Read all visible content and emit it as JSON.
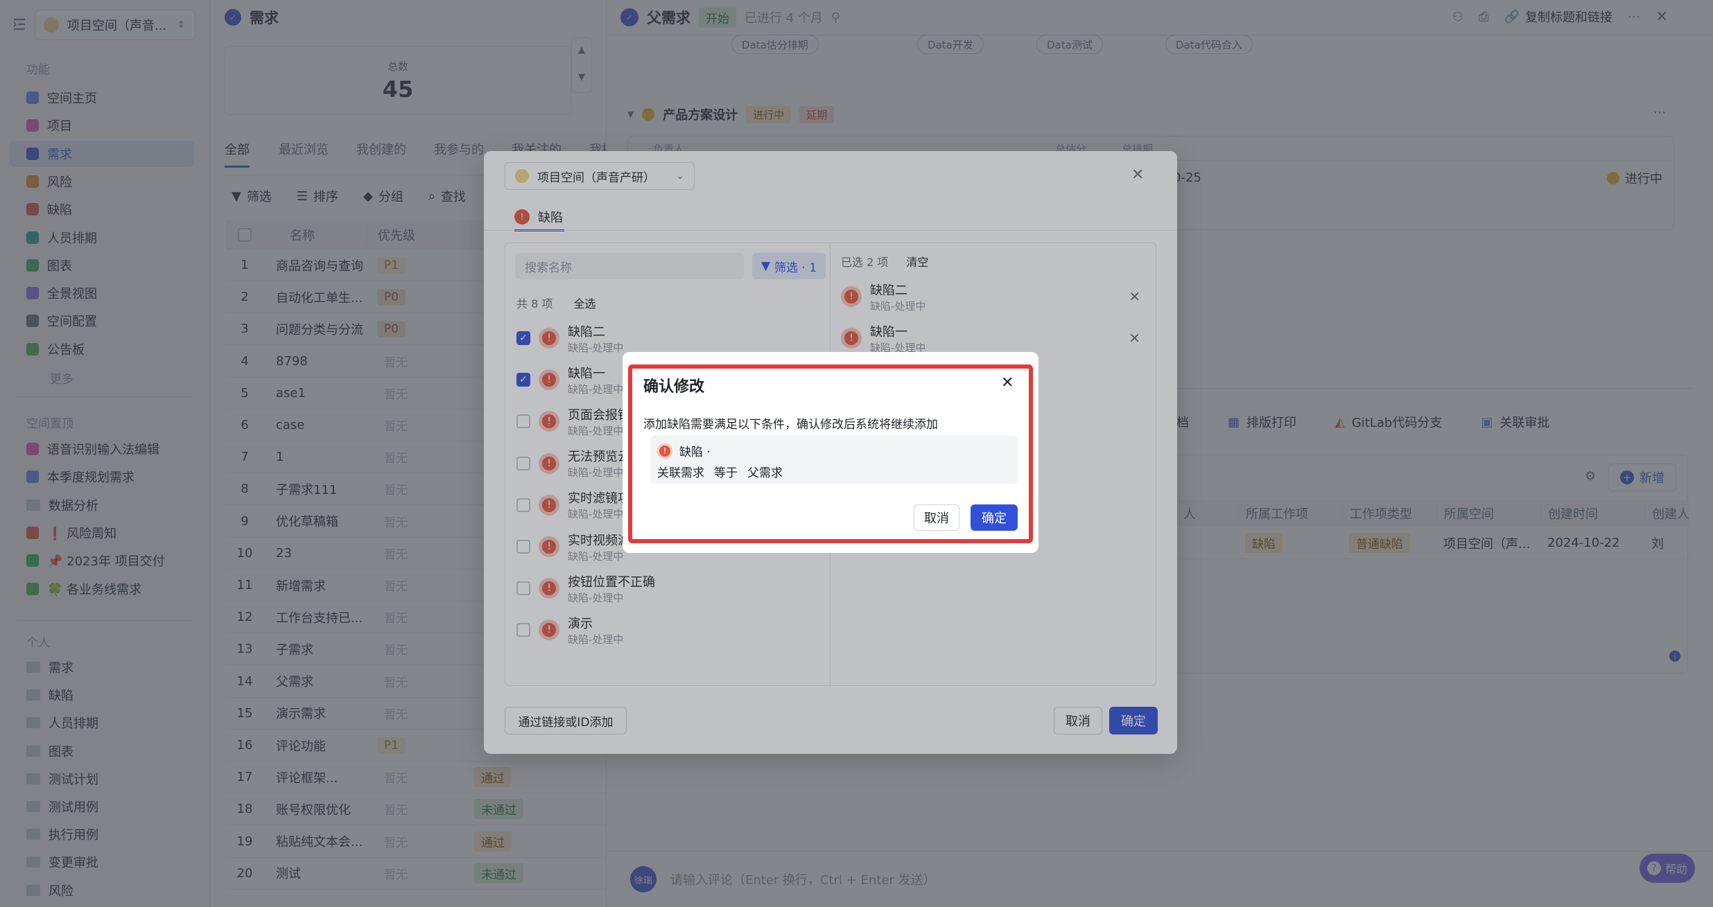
{
  "sidebar": {
    "workspace": "项目空间（声音...",
    "section_features": "功能",
    "features": [
      {
        "label": "空间主页",
        "color": "#6b7cf0"
      },
      {
        "label": "项目",
        "color": "#e05ba7"
      },
      {
        "label": "需求",
        "color": "#3250d8"
      },
      {
        "label": "风险",
        "color": "#e58a2a"
      },
      {
        "label": "缺陷",
        "color": "#e2553f"
      },
      {
        "label": "人员排期",
        "color": "#19a88b"
      },
      {
        "label": "图表",
        "color": "#2fb06b"
      },
      {
        "label": "全景视图",
        "color": "#8c6cf0"
      },
      {
        "label": "空间配置",
        "color": "#646a73"
      },
      {
        "label": "公告板",
        "color": "#43b347"
      }
    ],
    "more": "更多",
    "section_pinned": "空间置顶",
    "pinned": [
      {
        "label": "语音识别输入法编辑",
        "color": "#e05ba7"
      },
      {
        "label": "本季度规划需求",
        "color": "#6b7cf0"
      },
      {
        "label": "数据分析",
        "color": ""
      },
      {
        "label": "❗ 风险周知",
        "color": "#e2553f"
      },
      {
        "label": "📌 2023年 项目交付",
        "color": "#2fb06b"
      },
      {
        "label": "🍀 各业务线需求",
        "color": "#43b347"
      }
    ],
    "section_personal": "个人",
    "personal": [
      "需求",
      "缺陷",
      "人员排期",
      "图表",
      "测试计划",
      "测试用例",
      "执行用例",
      "变更审批",
      "风险"
    ]
  },
  "list": {
    "title": "需求",
    "total_label": "总数",
    "total_value": "45",
    "tabs": [
      "全部",
      "最近浏览",
      "我创建的",
      "我参与的",
      "我关注的",
      "我批"
    ],
    "toolbar": [
      "筛选",
      "排序",
      "分组",
      "查找"
    ],
    "col_name": "名称",
    "col_priority": "优先级",
    "rows": [
      {
        "n": "1",
        "name": "商品咨询与查询",
        "pri": "P1",
        "pc": "p1",
        "st": "",
        "sc": ""
      },
      {
        "n": "2",
        "name": "自动化工单生...",
        "pri": "P0",
        "pc": "p0",
        "st": "",
        "sc": ""
      },
      {
        "n": "3",
        "name": "问题分类与分流",
        "pri": "P0",
        "pc": "p0",
        "st": "",
        "sc": ""
      },
      {
        "n": "4",
        "name": "8798",
        "pri": "暂无",
        "pc": "pnone",
        "st": "",
        "sc": ""
      },
      {
        "n": "5",
        "name": "ase1",
        "pri": "暂无",
        "pc": "pnone",
        "st": "",
        "sc": ""
      },
      {
        "n": "6",
        "name": "case",
        "pri": "暂无",
        "pc": "pnone",
        "st": "",
        "sc": ""
      },
      {
        "n": "7",
        "name": "1",
        "pri": "暂无",
        "pc": "pnone",
        "st": "",
        "sc": ""
      },
      {
        "n": "8",
        "name": "子需求111",
        "pri": "暂无",
        "pc": "pnone",
        "st": "",
        "sc": ""
      },
      {
        "n": "9",
        "name": "优化草稿箱",
        "pri": "暂无",
        "pc": "pnone",
        "st": "",
        "sc": ""
      },
      {
        "n": "10",
        "name": "23",
        "pri": "暂无",
        "pc": "pnone",
        "st": "",
        "sc": ""
      },
      {
        "n": "11",
        "name": "新增需求",
        "pri": "暂无",
        "pc": "pnone",
        "st": "",
        "sc": ""
      },
      {
        "n": "12",
        "name": "工作台支持已...",
        "pri": "暂无",
        "pc": "pnone",
        "st": "",
        "sc": ""
      },
      {
        "n": "13",
        "name": "子需求",
        "pri": "暂无",
        "pc": "pnone",
        "st": "",
        "sc": ""
      },
      {
        "n": "14",
        "name": "父需求",
        "pri": "暂无",
        "pc": "pnone",
        "st": "",
        "sc": ""
      },
      {
        "n": "15",
        "name": "演示需求",
        "pri": "暂无",
        "pc": "pnone",
        "st": "",
        "sc": ""
      },
      {
        "n": "16",
        "name": "评论功能",
        "pri": "P1",
        "pc": "p1",
        "st": "",
        "sc": ""
      },
      {
        "n": "17",
        "name": "评论框架...",
        "pri": "暂无",
        "pc": "pnone",
        "st": "通过",
        "sc": "pass"
      },
      {
        "n": "18",
        "name": "账号权限优化",
        "pri": "暂无",
        "pc": "pnone",
        "st": "未通过",
        "sc": "nopass"
      },
      {
        "n": "19",
        "name": "粘贴纯文本会...",
        "pri": "暂无",
        "pc": "pnone",
        "st": "通过",
        "sc": "pass"
      },
      {
        "n": "20",
        "name": "测试",
        "pri": "暂无",
        "pc": "pnone",
        "st": "未通过",
        "sc": "nopass"
      }
    ]
  },
  "detail": {
    "title": "父需求",
    "status": "开始",
    "elapsed": "已进行 4 个月",
    "copy_link": "复制标题和链接",
    "flow_nodes": [
      "Data估分排期",
      "Data开发",
      "Data测试",
      "Data代码合入"
    ],
    "stage_name": "产品方案设计",
    "stage_status": "进行中",
    "stage_delay": "延期",
    "stage_col_owner": "负责人",
    "stage_col_points": "总估分",
    "stage_col_schedule": "总排期",
    "stage_date": "0-25",
    "stage_state": "进行中",
    "tabs_lower": [
      "档",
      "排版打印",
      "GitLab代码分支",
      "关联审批"
    ],
    "new_label": "新增",
    "table_cols": [
      "人",
      "所属工作项",
      "工作项类型",
      "所属空间",
      "创建时间",
      "创建人"
    ],
    "table_row": [
      "",
      "缺陷",
      "普通缺陷",
      "项目空间（声...",
      "2024-10-22",
      "刘"
    ],
    "comment_avatar": "徐瑞",
    "comment_placeholder": "请输入评论（Enter 换行，Ctrl + Enter 发送）",
    "help": "帮助"
  },
  "dialog": {
    "space_select": "项目空间（声音产研）",
    "tab": "缺陷",
    "search_placeholder": "搜索名称",
    "filter_label": "筛选 · 1",
    "total_label": "共 8 项",
    "select_all": "全选",
    "items": [
      {
        "name": "缺陷二",
        "sub": "缺陷-处理中",
        "checked": true
      },
      {
        "name": "缺陷一",
        "sub": "缺陷-处理中",
        "checked": true
      },
      {
        "name": "页面会报错",
        "sub": "缺陷-处理中",
        "checked": false
      },
      {
        "name": "无法预览云",
        "sub": "缺陷-处理中",
        "checked": false
      },
      {
        "name": "实时滤镜功",
        "sub": "缺陷-处理中",
        "checked": false
      },
      {
        "name": "实时视频滤",
        "sub": "缺陷-处理中",
        "checked": false
      },
      {
        "name": "按钮位置不正确",
        "sub": "缺陷-处理中",
        "checked": false
      },
      {
        "name": "演示",
        "sub": "缺陷-处理中",
        "checked": false
      }
    ],
    "selected_label": "已选 2 项",
    "clear": "清空",
    "selected": [
      {
        "name": "缺陷二",
        "sub": "缺陷-处理中"
      },
      {
        "name": "缺陷一",
        "sub": "缺陷-处理中"
      }
    ],
    "add_by_link": "通过链接或ID添加",
    "cancel": "取消",
    "ok": "确定"
  },
  "confirm": {
    "title": "确认修改",
    "message": "添加缺陷需要满足以下条件，确认修改后系统将继续添加",
    "cond_type": "缺陷 ·",
    "cond_field": "关联需求",
    "cond_op": "等于",
    "cond_value": "父需求",
    "cancel": "取消",
    "ok": "确定"
  },
  "colors": {
    "primary": "#3250d8",
    "danger": "#e2553f",
    "highlight_border": "#e53a3a"
  }
}
